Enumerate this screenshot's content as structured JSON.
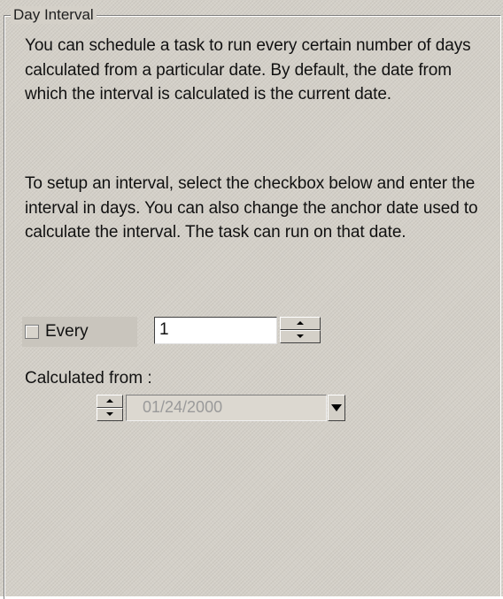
{
  "group": {
    "title": "Day Interval"
  },
  "description": {
    "paragraph1": "You can schedule a task to run every certain number of days calculated from a particular date. By default, the date from which the interval is calculated is the current date.",
    "paragraph2": "To setup an interval, select the checkbox below and enter the interval in days. You can also change the anchor date used to calculate the interval. The task can run on that date."
  },
  "every": {
    "label": "Every",
    "checked": false,
    "value": "1"
  },
  "calculated_from": {
    "label": "Calculated from :",
    "date": "01/24/2000",
    "enabled": false
  },
  "icons": {
    "spinner_up": "arrow-up-icon",
    "spinner_down": "arrow-down-icon",
    "dropdown": "chevron-down-icon"
  },
  "colors": {
    "panel_background": "#d4d0c8",
    "disabled_text": "#9a9a9a",
    "text": "#111111"
  }
}
